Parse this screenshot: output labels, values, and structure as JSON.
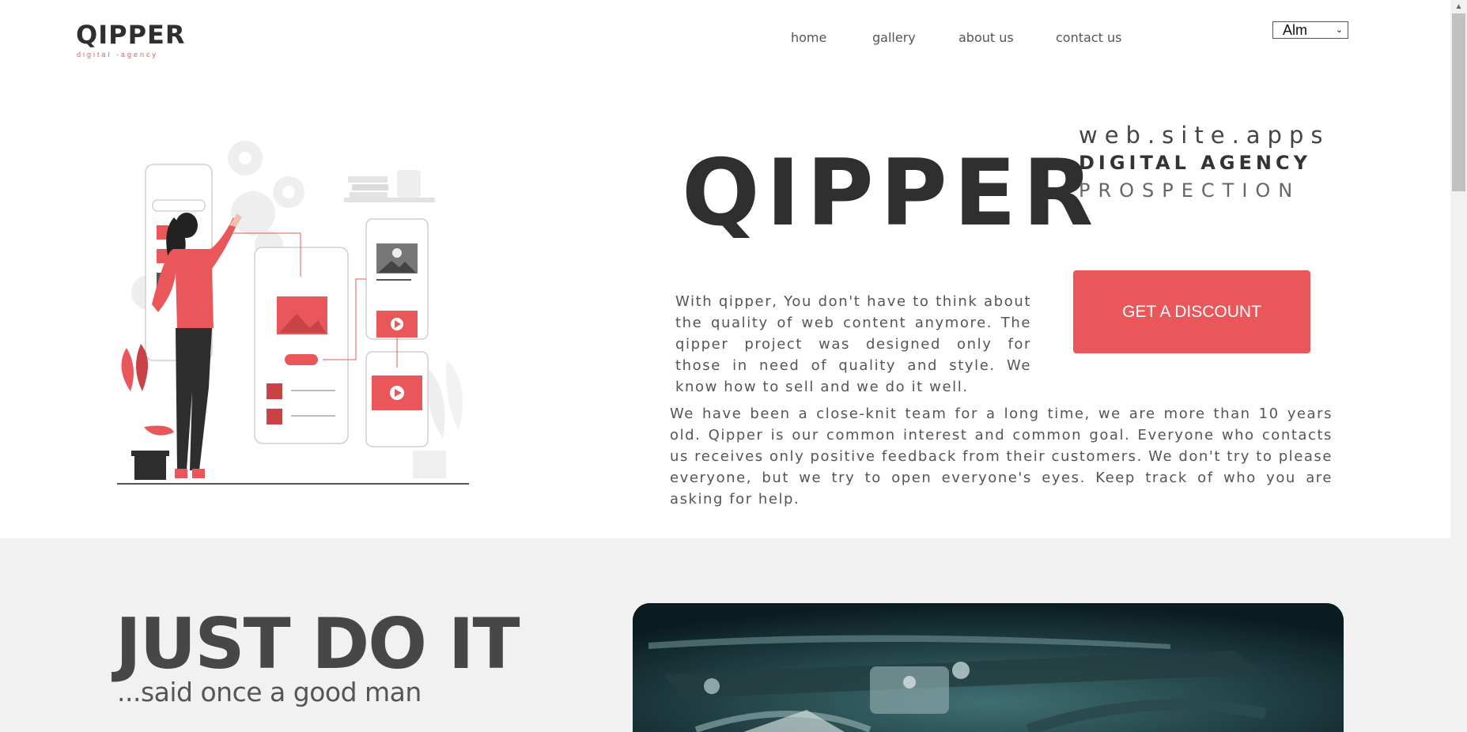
{
  "header": {
    "logo_text": "QIPPER",
    "logo_subtitle": "digital -agency",
    "nav": [
      {
        "label": "home"
      },
      {
        "label": "gallery"
      },
      {
        "label": "about us"
      },
      {
        "label": "contact us"
      }
    ],
    "language": {
      "selected": "Alm"
    }
  },
  "hero": {
    "title": "QIPPER",
    "taglines": [
      "web.site.apps",
      "DIGITAL AGENCY",
      "PROSPECTION"
    ],
    "intro": "With qipper, You don't have to think about the quality of web content anymore. The qipper project was designed only for those in need of quality and style. We know how to sell and we do it well.",
    "about": "We have been a close-knit team for a long time, we are more than 10 years old. Qipper is our common interest and common goal. Everyone who contacts us receives only positive feedback from their customers. We don't try to please everyone, but we try to open everyone's eyes. Keep track of who you are asking for help.",
    "cta_label": "GET A DISCOUNT"
  },
  "section2": {
    "heading": "JUST DO IT",
    "subheading": "...said once a good man"
  },
  "colors": {
    "accent": "#e9575b",
    "dark": "#2f2f2f",
    "section_bg": "#f1f1f1"
  }
}
